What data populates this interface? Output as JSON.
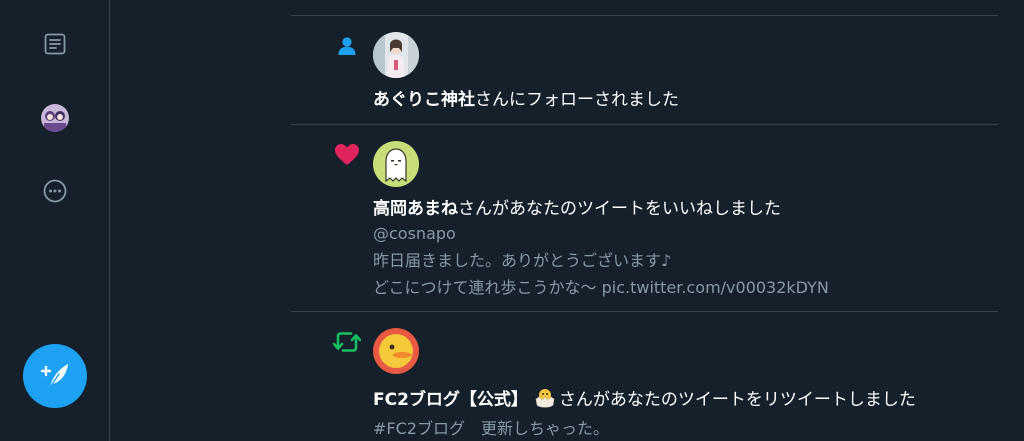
{
  "sidebar": {
    "items": [
      {
        "name": "lists",
        "icon": "document-list-icon"
      },
      {
        "name": "profile",
        "icon": "profile-avatar"
      },
      {
        "name": "more",
        "icon": "more-circle-icon"
      }
    ],
    "compose_icon": "compose-feather-icon"
  },
  "notifications": [
    {
      "type": "follow",
      "icon": "person-icon",
      "icon_color": "#1da1f2",
      "actor": "あぐりこ神社",
      "action": "さんにフォローされました"
    },
    {
      "type": "like",
      "icon": "heart-icon",
      "icon_color": "#e0245e",
      "actor": "高岡あまね",
      "action": "さんがあなたのツイートをいいねしました",
      "handle": "@cosnapo",
      "tweet_lines": [
        "昨日届きました。ありがとうございます♪",
        "どこにつけて連れ歩こうかな〜 pic.twitter.com/v00032kDYN"
      ]
    },
    {
      "type": "retweet",
      "icon": "retweet-icon",
      "icon_color": "#17bf63",
      "actor": "FC2ブログ【公式】",
      "actor_badge": "hatching-chick-icon",
      "action": "さんがあなたのツイートをリツイートしました",
      "tweet_lines": [
        "#FC2ブログ　更新しちゃった。"
      ]
    }
  ],
  "colors": {
    "background": "#15202b",
    "border": "#38444d",
    "text": "#ffffff",
    "muted": "#8899a6",
    "accent": "#1da1f2"
  }
}
